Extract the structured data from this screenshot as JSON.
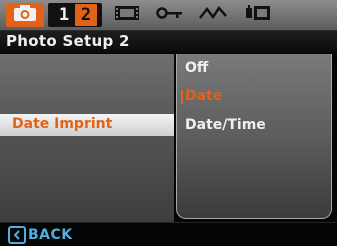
{
  "tabs": {
    "camera_icon": "camera-icon",
    "pages": [
      "1",
      "2"
    ],
    "active_page": "2",
    "movie_icon": "movie-icon",
    "key_icon": "key-icon",
    "wave_icon": "waveform-icon",
    "tool_icon": "setup-tool-icon"
  },
  "title": "Photo Setup 2",
  "menu": {
    "items": [
      {
        "label": "Date Imprint",
        "selected": true
      }
    ]
  },
  "options": {
    "items": [
      {
        "label": "Off"
      },
      {
        "label": "Date",
        "selected": true
      },
      {
        "label": "Date/Time"
      }
    ]
  },
  "footer": {
    "back_label": "BACK"
  },
  "colors": {
    "accent": "#e3621a",
    "back": "#4fb0e0"
  }
}
